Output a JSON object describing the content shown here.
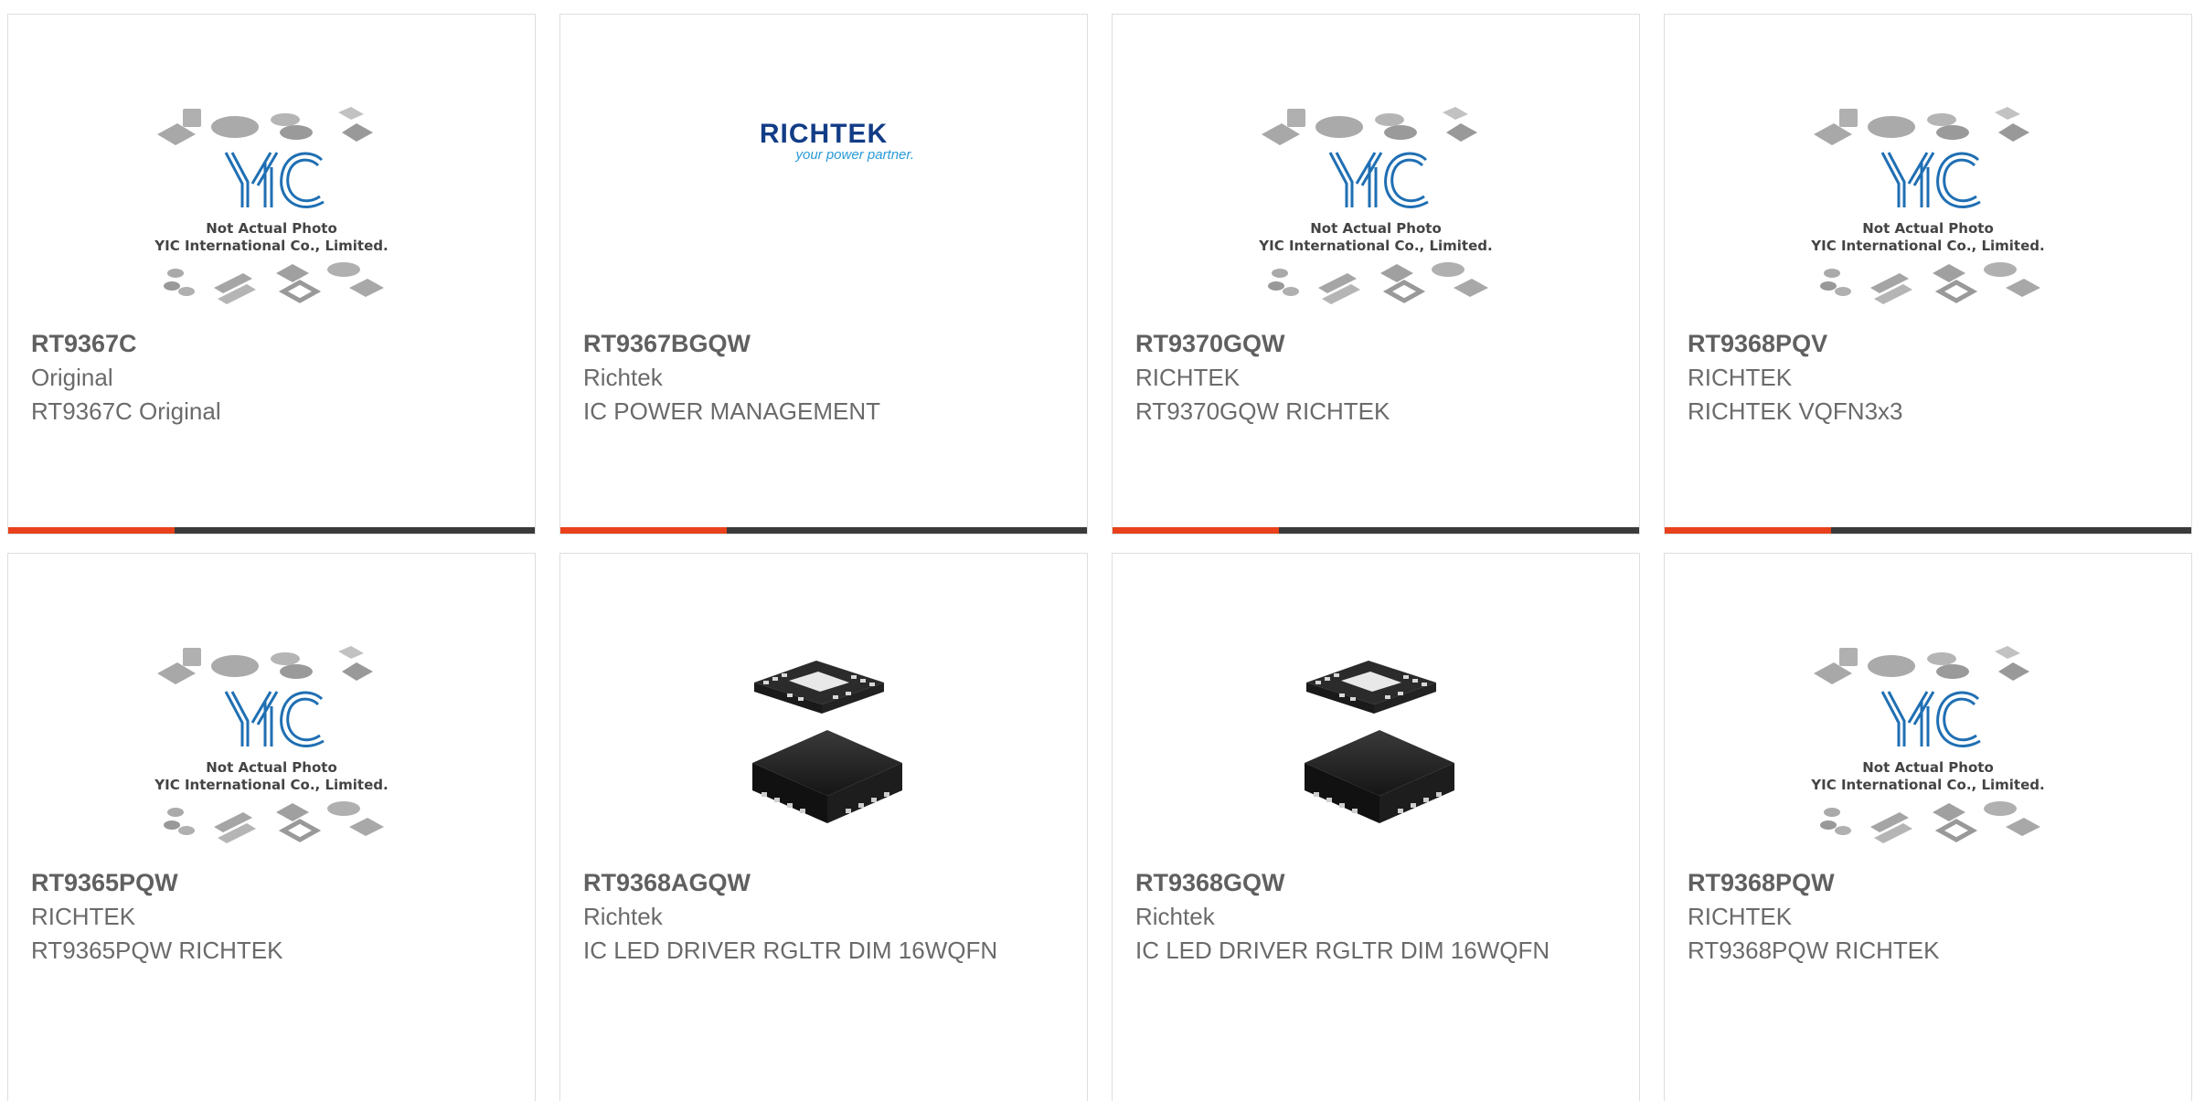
{
  "placeholder": {
    "line1": "Not Actual Photo",
    "line2": "YIC International Co., Limited.",
    "logo_text": "YIC"
  },
  "richtek_logo": {
    "brand": "RICHTEK",
    "tagline": "your power partner."
  },
  "colors": {
    "accent": "#e8411b",
    "bar": "#3a3a3a",
    "yic_blue": "#1f6fb3",
    "richtek_blue": "#123c86"
  },
  "products": [
    {
      "part": "RT9367C",
      "manufacturer": "Original",
      "description": "RT9367C Original",
      "image": "yic-placeholder-icon"
    },
    {
      "part": "RT9367BGQW",
      "manufacturer": "Richtek",
      "description": "IC POWER MANAGEMENT",
      "image": "richtek-logo-icon"
    },
    {
      "part": "RT9370GQW",
      "manufacturer": "RICHTEK",
      "description": "RT9370GQW RICHTEK",
      "image": "yic-placeholder-icon"
    },
    {
      "part": "RT9368PQV",
      "manufacturer": "RICHTEK",
      "description": "RICHTEK VQFN3x3",
      "image": "yic-placeholder-icon"
    },
    {
      "part": "RT9365PQW",
      "manufacturer": "RICHTEK",
      "description": "RT9365PQW RICHTEK",
      "image": "yic-placeholder-icon"
    },
    {
      "part": "RT9368AGQW",
      "manufacturer": "Richtek",
      "description": "IC LED DRIVER RGLTR DIM 16WQFN",
      "image": "qfn-chip-icon"
    },
    {
      "part": "RT9368GQW",
      "manufacturer": "Richtek",
      "description": "IC LED DRIVER RGLTR DIM 16WQFN",
      "image": "qfn-chip-icon"
    },
    {
      "part": "RT9368PQW",
      "manufacturer": "RICHTEK",
      "description": "RT9368PQW RICHTEK",
      "image": "yic-placeholder-icon"
    }
  ]
}
